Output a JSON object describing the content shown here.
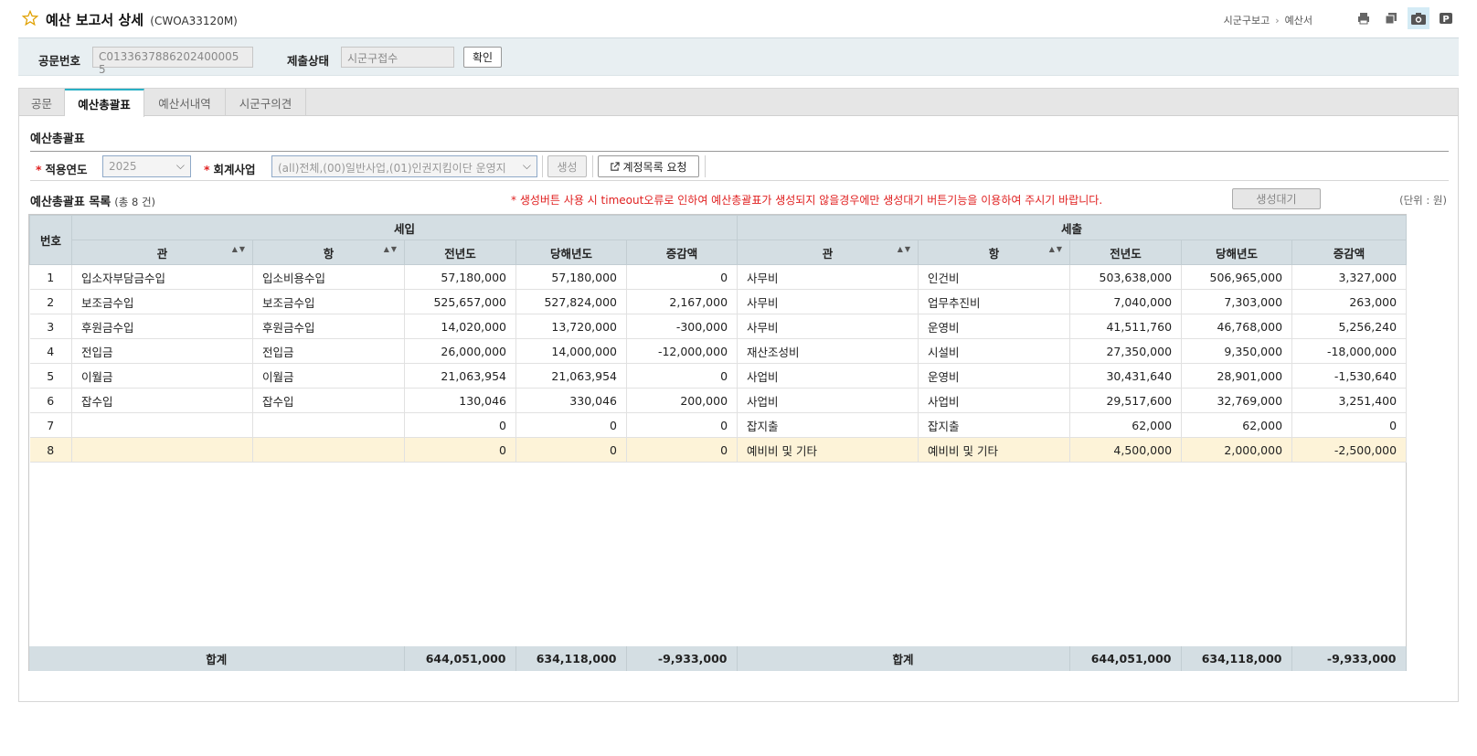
{
  "header": {
    "title": "예산 보고서 상세",
    "code": "(CWOA33120M)",
    "breadcrumb": [
      "시군구보고",
      "예산서"
    ]
  },
  "search": {
    "doc_no_label": "공문번호",
    "doc_no_value": "C0133637886202400005 5",
    "status_label": "제출상태",
    "status_value": "시군구접수",
    "confirm_label": "확인"
  },
  "tabs": [
    {
      "label": "공문"
    },
    {
      "label": "예산총괄표"
    },
    {
      "label": "예산서내역"
    },
    {
      "label": "시군구의견"
    }
  ],
  "section_title": "예산총괄표",
  "filter": {
    "year_label": "적용연도",
    "year_value": "2025",
    "biz_label": "회계사업",
    "biz_value": "(all)전체,(00)일반사업,(01)인권지킴이단 운영지",
    "generate_label": "생성",
    "request_label": "계정목록 요청",
    "required_mark": "*"
  },
  "list": {
    "title": "예산총괄표 목록",
    "count": "(총 8 건)",
    "warning": "* 생성버튼 사용 시 timeout오류로 인하여 예산총괄표가 생성되지 않을경우에만 생성대기 버튼기능을 이용하여 주시기 바랍니다.",
    "wait_label": "생성대기",
    "unit": "(단위 : 원)"
  },
  "table": {
    "group_headers": {
      "no": "번호",
      "income": "세입",
      "expense": "세출"
    },
    "sub_headers": [
      "관",
      "항",
      "전년도",
      "당해년도",
      "증감액",
      "관",
      "항",
      "전년도",
      "당해년도",
      "증감액"
    ],
    "rows": [
      {
        "no": "1",
        "ig": "입소자부담금수입",
        "ih": "입소비용수입",
        "ip": "57,180,000",
        "ic": "57,180,000",
        "id": "0",
        "eg": "사무비",
        "eh": "인건비",
        "ep": "503,638,000",
        "ec": "506,965,000",
        "ed": "3,327,000"
      },
      {
        "no": "2",
        "ig": "보조금수입",
        "ih": "보조금수입",
        "ip": "525,657,000",
        "ic": "527,824,000",
        "id": "2,167,000",
        "eg": "사무비",
        "eh": "업무추진비",
        "ep": "7,040,000",
        "ec": "7,303,000",
        "ed": "263,000"
      },
      {
        "no": "3",
        "ig": "후원금수입",
        "ih": "후원금수입",
        "ip": "14,020,000",
        "ic": "13,720,000",
        "id": "-300,000",
        "eg": "사무비",
        "eh": "운영비",
        "ep": "41,511,760",
        "ec": "46,768,000",
        "ed": "5,256,240"
      },
      {
        "no": "4",
        "ig": "전입금",
        "ih": "전입금",
        "ip": "26,000,000",
        "ic": "14,000,000",
        "id": "-12,000,000",
        "eg": "재산조성비",
        "eh": "시설비",
        "ep": "27,350,000",
        "ec": "9,350,000",
        "ed": "-18,000,000"
      },
      {
        "no": "5",
        "ig": "이월금",
        "ih": "이월금",
        "ip": "21,063,954",
        "ic": "21,063,954",
        "id": "0",
        "eg": "사업비",
        "eh": "운영비",
        "ep": "30,431,640",
        "ec": "28,901,000",
        "ed": "-1,530,640"
      },
      {
        "no": "6",
        "ig": "잡수입",
        "ih": "잡수입",
        "ip": "130,046",
        "ic": "330,046",
        "id": "200,000",
        "eg": "사업비",
        "eh": "사업비",
        "ep": "29,517,600",
        "ec": "32,769,000",
        "ed": "3,251,400"
      },
      {
        "no": "7",
        "ig": "",
        "ih": "",
        "ip": "0",
        "ic": "0",
        "id": "0",
        "eg": "잡지출",
        "eh": "잡지출",
        "ep": "62,000",
        "ec": "62,000",
        "ed": "0"
      },
      {
        "no": "8",
        "ig": "",
        "ih": "",
        "ip": "0",
        "ic": "0",
        "id": "0",
        "eg": "예비비 및 기타",
        "eh": "예비비 및 기타",
        "ep": "4,500,000",
        "ec": "2,000,000",
        "ed": "-2,500,000"
      }
    ],
    "footer": {
      "income_label": "합계",
      "ip": "644,051,000",
      "ic": "634,118,000",
      "id": "-9,933,000",
      "expense_label": "합계",
      "ep": "644,051,000",
      "ec": "634,118,000",
      "ed": "-9,933,000"
    }
  }
}
